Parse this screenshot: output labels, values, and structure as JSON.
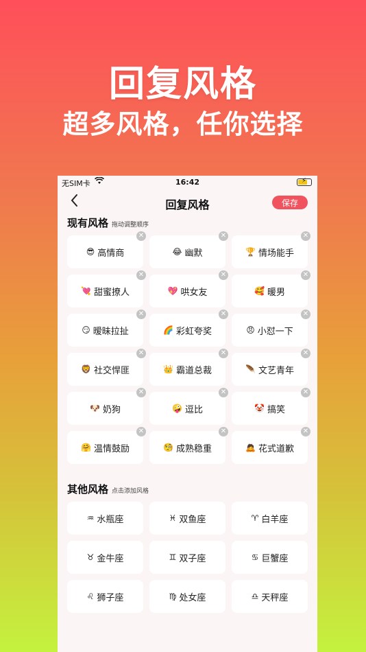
{
  "hero": {
    "title": "回复风格",
    "subtitle": "超多风格，任你选择"
  },
  "status_bar": {
    "carrier": "无SIM卡",
    "time": "16:42"
  },
  "nav": {
    "title": "回复风格",
    "save_label": "保存"
  },
  "current": {
    "heading": "现有风格",
    "hint": "拖动调整顺序",
    "items": [
      {
        "emoji": "😎",
        "label": "高情商"
      },
      {
        "emoji": "😂",
        "label": "幽默"
      },
      {
        "emoji": "🏆",
        "label": "情场能手"
      },
      {
        "emoji": "💘",
        "label": "甜蜜撩人"
      },
      {
        "emoji": "💖",
        "label": "哄女友"
      },
      {
        "emoji": "🥰",
        "label": "暖男"
      },
      {
        "emoji": "😏",
        "label": "暧昧拉扯"
      },
      {
        "emoji": "🌈",
        "label": "彩虹夸奖"
      },
      {
        "emoji": "😠",
        "label": "小怼一下"
      },
      {
        "emoji": "🦁",
        "label": "社交悍匪"
      },
      {
        "emoji": "👑",
        "label": "霸道总裁"
      },
      {
        "emoji": "🪶",
        "label": "文艺青年"
      },
      {
        "emoji": "🐶",
        "label": "奶狗"
      },
      {
        "emoji": "🤪",
        "label": "逗比"
      },
      {
        "emoji": "🤡",
        "label": "搞笑"
      },
      {
        "emoji": "🤗",
        "label": "温情鼓励"
      },
      {
        "emoji": "🧐",
        "label": "成熟稳重"
      },
      {
        "emoji": "🙇",
        "label": "花式道歉"
      }
    ]
  },
  "other": {
    "heading": "其他风格",
    "hint": "点击添加风格",
    "items": [
      {
        "emoji": "♒",
        "label": "水瓶座"
      },
      {
        "emoji": "♓",
        "label": "双鱼座"
      },
      {
        "emoji": "♈",
        "label": "白羊座"
      },
      {
        "emoji": "♉",
        "label": "金牛座"
      },
      {
        "emoji": "♊",
        "label": "双子座"
      },
      {
        "emoji": "♋",
        "label": "巨蟹座"
      },
      {
        "emoji": "♌",
        "label": "狮子座"
      },
      {
        "emoji": "♍",
        "label": "处女座"
      },
      {
        "emoji": "♎",
        "label": "天秤座"
      }
    ]
  },
  "colors": {
    "accent": "#f0525e",
    "card": "#ffffff",
    "screen_bg": "#fbf5f5"
  }
}
